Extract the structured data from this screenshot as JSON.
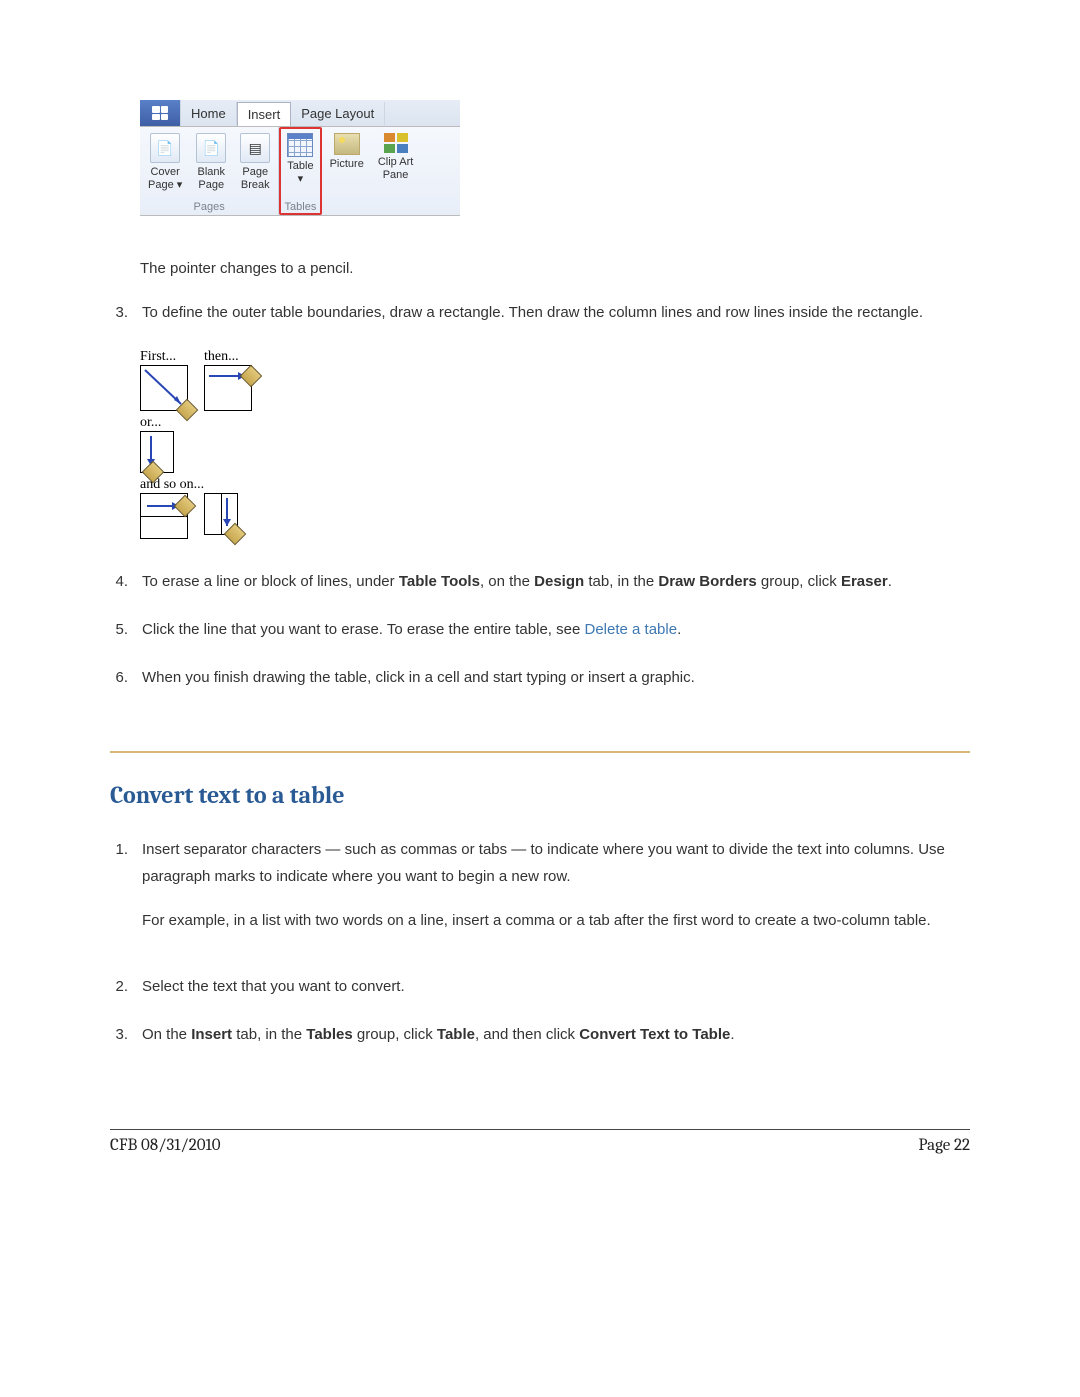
{
  "ribbon": {
    "tabs": {
      "home": "Home",
      "insert": "Insert",
      "pagelayout": "Page Layout"
    },
    "buttons": {
      "cover_page": "Cover\nPage ▾",
      "blank_page": "Blank\nPage",
      "page_break": "Page\nBreak",
      "table": "Table\n▾",
      "picture": "Picture",
      "clipart": "Clip Art\nPane"
    },
    "groups": {
      "pages": "Pages",
      "tables": "Tables"
    }
  },
  "p_pointer": "The pointer changes to a pencil.",
  "step3": {
    "num": "3.",
    "text": "To define the outer table boundaries, draw a rectangle. Then draw the column lines and row lines inside the rectangle."
  },
  "diag": {
    "first": "First...",
    "then": "then...",
    "or": "or...",
    "andsoon": "and so on..."
  },
  "step4": {
    "num": "4.",
    "t1": "To erase a line or block of lines, under ",
    "b1": "Table Tools",
    "t2": ", on the ",
    "b2": "Design",
    "t3": " tab, in the ",
    "b3": "Draw Borders",
    "t4": " group, click ",
    "b4": "Eraser",
    "t5": "."
  },
  "step5": {
    "num": "5.",
    "t1": "Click the line that you want to erase. To erase the entire table, see ",
    "link": "Delete a table",
    "t2": "."
  },
  "step6": {
    "num": "6.",
    "text": "When you finish drawing the table, click in a cell and start typing or insert a graphic."
  },
  "heading_convert": "Convert text to a table",
  "cstep1": {
    "num": "1.",
    "p1": "Insert separator characters — such as commas or tabs — to indicate where you want to divide the text into columns. Use paragraph marks to indicate where you want to begin a new row.",
    "p2": "For example, in a list with two words on a line, insert a comma or a tab after the first word to create a two-column table."
  },
  "cstep2": {
    "num": "2.",
    "text": "Select the text that you want to convert."
  },
  "cstep3": {
    "num": "3.",
    "t1": "On the ",
    "b1": "Insert",
    "t2": " tab, in the ",
    "b2": "Tables",
    "t3": " group, click ",
    "b3": "Table",
    "t4": ", and then click ",
    "b4": "Convert Text to Table",
    "t5": "."
  },
  "footer": {
    "left": "CFB 08/31/2010",
    "right": "Page 22"
  }
}
